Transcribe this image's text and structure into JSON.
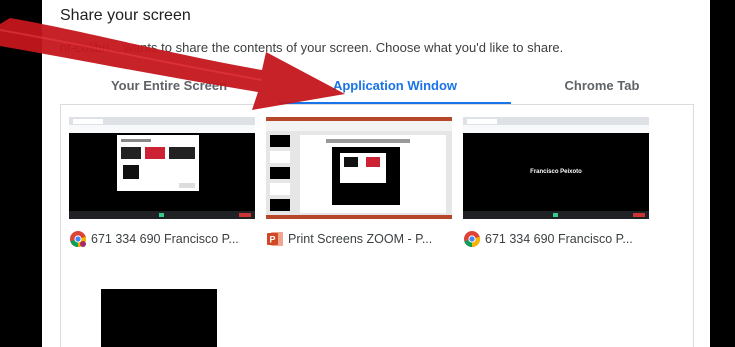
{
  "dialog": {
    "title": "Share your screen",
    "subtitle": "nf-colibri... wants to share the contents of your screen. Choose what you'd like to share."
  },
  "tabs": [
    {
      "label": "Your Entire Screen",
      "active": false
    },
    {
      "label": "Application Window",
      "active": true
    },
    {
      "label": "Chrome Tab",
      "active": false
    }
  ],
  "windows": [
    {
      "title": "671 334 690 Francisco P...",
      "icon": "chrome-icon"
    },
    {
      "title": "Print Screens ZOOM - P...",
      "icon": "powerpoint-icon"
    },
    {
      "title": "671 334 690 Francisco P...",
      "icon": "chrome-icon"
    }
  ],
  "thumbnail_text": {
    "presenter": "Francisco Peixoto"
  },
  "colors": {
    "accent": "#1a73e8",
    "arrow": "#c4161c",
    "powerpoint": "#d24726"
  }
}
